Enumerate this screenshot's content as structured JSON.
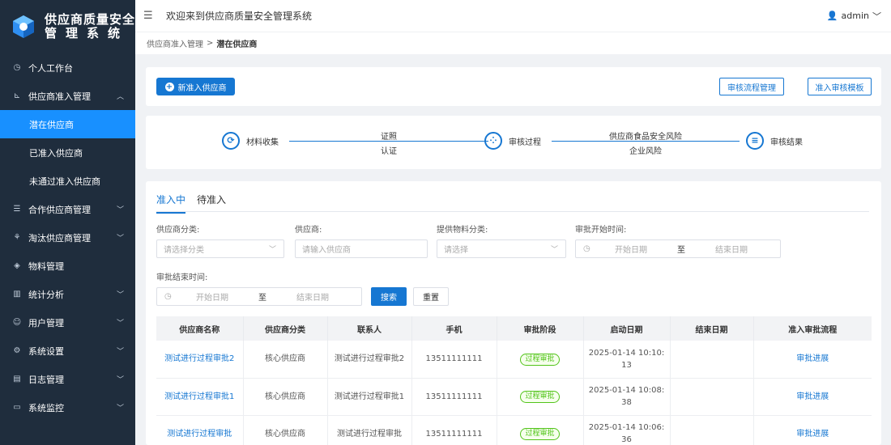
{
  "app": {
    "logo_line1": "供应商质量安全",
    "logo_line2": "管理系统",
    "welcome": "欢迎来到供应商质量安全管理系统",
    "user": "admin"
  },
  "sidebar": {
    "items": [
      {
        "label": "个人工作台",
        "icon": "dashboard-icon"
      },
      {
        "label": "供应商准入管理",
        "icon": "chart-icon",
        "expanded": true,
        "children": [
          {
            "label": "潜在供应商",
            "active": true
          },
          {
            "label": "已准入供应商"
          },
          {
            "label": "未通过准入供应商"
          }
        ]
      },
      {
        "label": "合作供应商管理",
        "icon": "list-icon"
      },
      {
        "label": "淘汰供应商管理",
        "icon": "trash-icon"
      },
      {
        "label": "物料管理",
        "icon": "layers-icon"
      },
      {
        "label": "统计分析",
        "icon": "bar-chart-icon"
      },
      {
        "label": "用户管理",
        "icon": "users-icon"
      },
      {
        "label": "系统设置",
        "icon": "gear-icon"
      },
      {
        "label": "日志管理",
        "icon": "document-icon"
      },
      {
        "label": "系统监控",
        "icon": "monitor-icon"
      }
    ]
  },
  "breadcrumb": {
    "parent": "供应商准入管理",
    "separator": ">",
    "current": "潜在供应商"
  },
  "toolbar": {
    "add_label": "新准入供应商",
    "flow_label": "审核流程管理",
    "template_label": "准入审核模板"
  },
  "steps": {
    "step1": "材料收集",
    "line1_top": "证照",
    "line1_bottom": "认证",
    "step2": "审核过程",
    "line2_top": "供应商食品安全风险",
    "line2_bottom": "企业风险",
    "step3": "审核结果"
  },
  "tabs": [
    {
      "label": "准入中",
      "active": true
    },
    {
      "label": "待准入"
    }
  ],
  "filters": {
    "category_label": "供应商分类:",
    "category_placeholder": "请选择分类",
    "supplier_label": "供应商:",
    "supplier_placeholder": "请输入供应商",
    "material_label": "提供物料分类:",
    "material_placeholder": "请选择",
    "start_label": "审批开始时间:",
    "end_label": "审批结束时间:",
    "date_start": "开始日期",
    "date_to": "至",
    "date_end": "结束日期",
    "search": "搜索",
    "reset": "重置"
  },
  "table": {
    "headers": [
      "供应商名称",
      "供应商分类",
      "联系人",
      "手机",
      "审批阶段",
      "启动日期",
      "结束日期",
      "准入审批流程"
    ],
    "rows": [
      {
        "name": "测试进行过程审批2",
        "category": "核心供应商",
        "contact": "测试进行过程审批2",
        "phone": "13511111111",
        "stage": "过程审批",
        "start_a": "2025-01-14 10:10:",
        "start_b": "13",
        "end": "",
        "action": "审批进展"
      },
      {
        "name": "测试进行过程审批1",
        "category": "核心供应商",
        "contact": "测试进行过程审批1",
        "phone": "13511111111",
        "stage": "过程审批",
        "start_a": "2025-01-14 10:08:",
        "start_b": "38",
        "end": "",
        "action": "审批进展"
      },
      {
        "name": "测试进行过程审批",
        "category": "核心供应商",
        "contact": "测试进行过程审批",
        "phone": "13511111111",
        "stage": "过程审批",
        "start_a": "2025-01-14 10:06:",
        "start_b": "36",
        "end": "",
        "action": "审批进展"
      }
    ]
  },
  "colors": {
    "sidebar_bg": "#1f2d3d",
    "primary": "#1677d2",
    "active_menu": "#1890ff",
    "stage_green": "#52c41a"
  }
}
